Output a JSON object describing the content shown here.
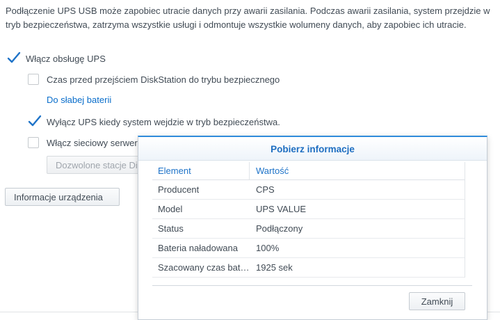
{
  "intro_text": "Podłączenie UPS USB może zapobiec utracie danych przy awarii zasilania. Podczas awarii zasilania, system przejdzie w tryb bezpieczeństwa, zatrzyma wszystkie usługi i odmontuje wszystkie wolumeny danych, aby zapobiec ich utracie.",
  "options": {
    "enable_ups": {
      "label": "Włącz obsługę UPS",
      "checked": true
    },
    "time_before_safe_mode": {
      "label": "Czas przed przejściem DiskStation do trybu bezpiecznego",
      "checked": false
    },
    "low_battery_link": "Do słabej baterii",
    "shutdown_ups": {
      "label": "Wyłącz UPS kiedy system wejdzie w tryb bezpieczeństwa.",
      "checked": true
    },
    "network_server": {
      "label": "Włącz sieciowy serwer UPS",
      "checked": false
    }
  },
  "buttons": {
    "allowed_stations": "Dozwolone stacje DiskStation",
    "device_info": "Informacje urządzenia"
  },
  "dialog": {
    "title": "Pobierz informacje",
    "columns": {
      "element": "Element",
      "value": "Wartość"
    },
    "rows": [
      {
        "element": "Producent",
        "value": "CPS"
      },
      {
        "element": "Model",
        "value": "UPS VALUE"
      },
      {
        "element": "Status",
        "value": "Podłączony"
      },
      {
        "element": "Bateria naładowana",
        "value": "100%"
      },
      {
        "element": "Szacowany czas baterii",
        "value": "1925 sek"
      }
    ],
    "close_button": "Zamknij"
  },
  "colors": {
    "accent": "#2f8bdb",
    "link": "#0a6ecb",
    "checkmark": "#1e73c8"
  },
  "icons": {
    "checkbox_checked": "checkmark-icon"
  }
}
